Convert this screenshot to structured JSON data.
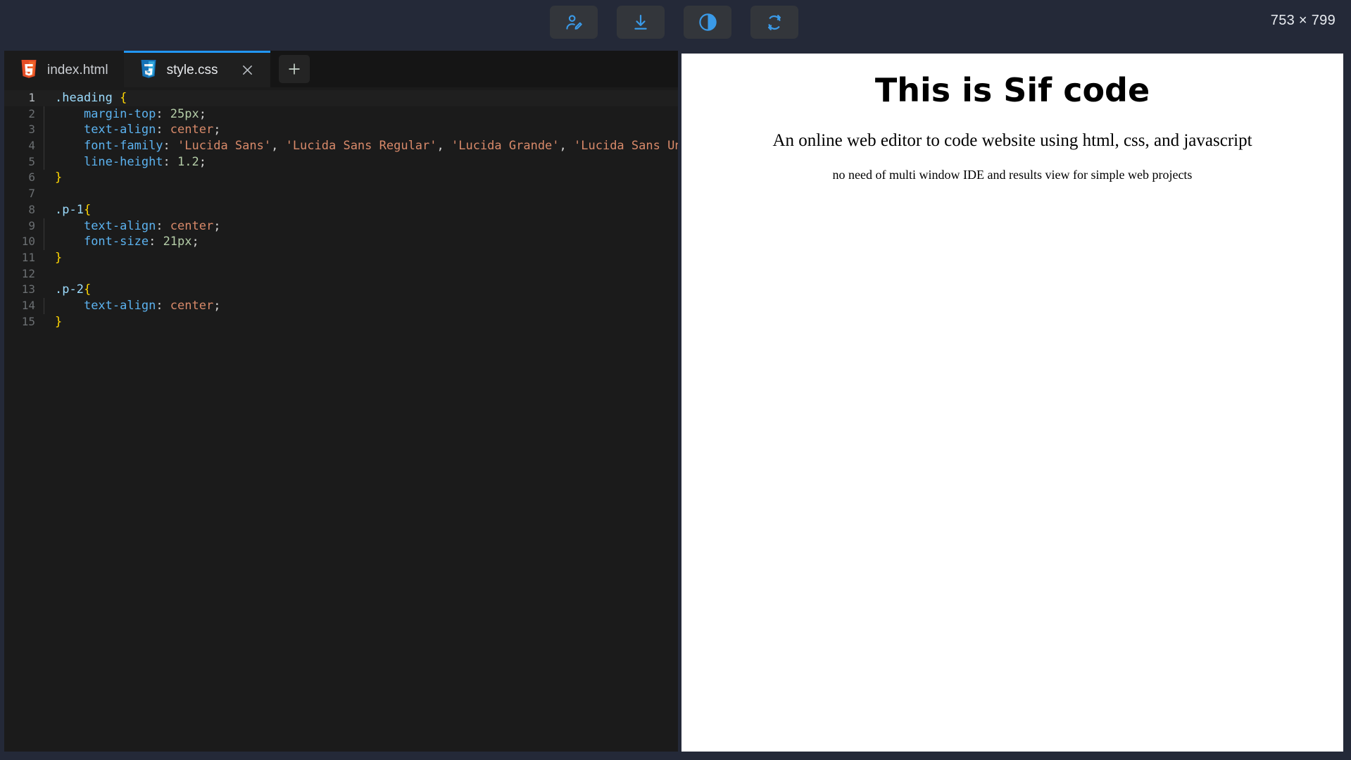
{
  "toolbar": {
    "buttons": [
      {
        "name": "account-edit-button",
        "icon": "user-edit-icon",
        "label": "Account"
      },
      {
        "name": "download-button",
        "icon": "download-icon",
        "label": "Download"
      },
      {
        "name": "theme-toggle-button",
        "icon": "contrast-icon",
        "label": "Theme"
      },
      {
        "name": "refresh-button",
        "icon": "refresh-icon",
        "label": "Refresh"
      }
    ],
    "dimensions": "753 × 799"
  },
  "editor": {
    "tabs": [
      {
        "label": "index.html",
        "icon": "html5-icon",
        "active": false,
        "closable": false
      },
      {
        "label": "style.css",
        "icon": "css3-icon",
        "active": true,
        "closable": true
      }
    ],
    "add_tab_label": "+",
    "close_label": "×",
    "active_line": 1,
    "lines": [
      {
        "n": "1",
        "guide": false,
        "tokens": [
          {
            "t": ".heading",
            "c": "t-sel"
          },
          {
            "t": " ",
            "c": "t-punct"
          },
          {
            "t": "{",
            "c": "t-brace"
          }
        ]
      },
      {
        "n": "2",
        "guide": true,
        "tokens": [
          {
            "t": "    ",
            "c": "t-punct"
          },
          {
            "t": "margin-top",
            "c": "t-prop"
          },
          {
            "t": ": ",
            "c": "t-punct"
          },
          {
            "t": "25px",
            "c": "t-num"
          },
          {
            "t": ";",
            "c": "t-punct"
          }
        ]
      },
      {
        "n": "3",
        "guide": true,
        "tokens": [
          {
            "t": "    ",
            "c": "t-punct"
          },
          {
            "t": "text-align",
            "c": "t-prop"
          },
          {
            "t": ": ",
            "c": "t-punct"
          },
          {
            "t": "center",
            "c": "t-val"
          },
          {
            "t": ";",
            "c": "t-punct"
          }
        ]
      },
      {
        "n": "4",
        "guide": true,
        "tokens": [
          {
            "t": "    ",
            "c": "t-punct"
          },
          {
            "t": "font-family",
            "c": "t-prop"
          },
          {
            "t": ": ",
            "c": "t-punct"
          },
          {
            "t": "'Lucida Sans'",
            "c": "t-str"
          },
          {
            "t": ", ",
            "c": "t-punct"
          },
          {
            "t": "'Lucida Sans Regular'",
            "c": "t-str"
          },
          {
            "t": ", ",
            "c": "t-punct"
          },
          {
            "t": "'Lucida Grande'",
            "c": "t-str"
          },
          {
            "t": ", ",
            "c": "t-punct"
          },
          {
            "t": "'Lucida Sans Unicode'",
            "c": "t-str"
          },
          {
            "t": ";",
            "c": "t-punct"
          }
        ]
      },
      {
        "n": "5",
        "guide": true,
        "tokens": [
          {
            "t": "    ",
            "c": "t-punct"
          },
          {
            "t": "line-height",
            "c": "t-prop"
          },
          {
            "t": ": ",
            "c": "t-punct"
          },
          {
            "t": "1.2",
            "c": "t-num"
          },
          {
            "t": ";",
            "c": "t-punct"
          }
        ]
      },
      {
        "n": "6",
        "guide": false,
        "tokens": [
          {
            "t": "}",
            "c": "t-brace"
          }
        ]
      },
      {
        "n": "7",
        "guide": false,
        "tokens": [
          {
            "t": "",
            "c": "t-punct"
          }
        ]
      },
      {
        "n": "8",
        "guide": false,
        "tokens": [
          {
            "t": ".p-1",
            "c": "t-sel"
          },
          {
            "t": "{",
            "c": "t-brace"
          }
        ]
      },
      {
        "n": "9",
        "guide": true,
        "tokens": [
          {
            "t": "    ",
            "c": "t-punct"
          },
          {
            "t": "text-align",
            "c": "t-prop"
          },
          {
            "t": ": ",
            "c": "t-punct"
          },
          {
            "t": "center",
            "c": "t-val"
          },
          {
            "t": ";",
            "c": "t-punct"
          }
        ]
      },
      {
        "n": "10",
        "guide": true,
        "tokens": [
          {
            "t": "    ",
            "c": "t-punct"
          },
          {
            "t": "font-size",
            "c": "t-prop"
          },
          {
            "t": ": ",
            "c": "t-punct"
          },
          {
            "t": "21px",
            "c": "t-num"
          },
          {
            "t": ";",
            "c": "t-punct"
          }
        ]
      },
      {
        "n": "11",
        "guide": false,
        "tokens": [
          {
            "t": "}",
            "c": "t-brace"
          }
        ]
      },
      {
        "n": "12",
        "guide": false,
        "tokens": [
          {
            "t": "",
            "c": "t-punct"
          }
        ]
      },
      {
        "n": "13",
        "guide": false,
        "tokens": [
          {
            "t": ".p-2",
            "c": "t-sel"
          },
          {
            "t": "{",
            "c": "t-brace"
          }
        ]
      },
      {
        "n": "14",
        "guide": true,
        "tokens": [
          {
            "t": "    ",
            "c": "t-punct"
          },
          {
            "t": "text-align",
            "c": "t-prop"
          },
          {
            "t": ": ",
            "c": "t-punct"
          },
          {
            "t": "center",
            "c": "t-val"
          },
          {
            "t": ";",
            "c": "t-punct"
          }
        ]
      },
      {
        "n": "15",
        "guide": false,
        "tokens": [
          {
            "t": "}",
            "c": "t-brace"
          }
        ]
      }
    ]
  },
  "preview": {
    "heading": "This is Sif code",
    "paragraph_1": "An online web editor to code website using html, css, and javascript",
    "paragraph_2": "no need of multi window IDE and results view for simple web projects"
  },
  "colors": {
    "app_background": "#242938",
    "editor_background": "#1b1b1b",
    "tabbar_background": "#151515",
    "active_tab_accent": "#2196f3",
    "toolbar_button_background": "#33363b",
    "icon_accent": "#3a9ae8",
    "preview_background": "#ffffff",
    "html5_icon": "#e44d26",
    "css3_icon": "#1572b6"
  }
}
